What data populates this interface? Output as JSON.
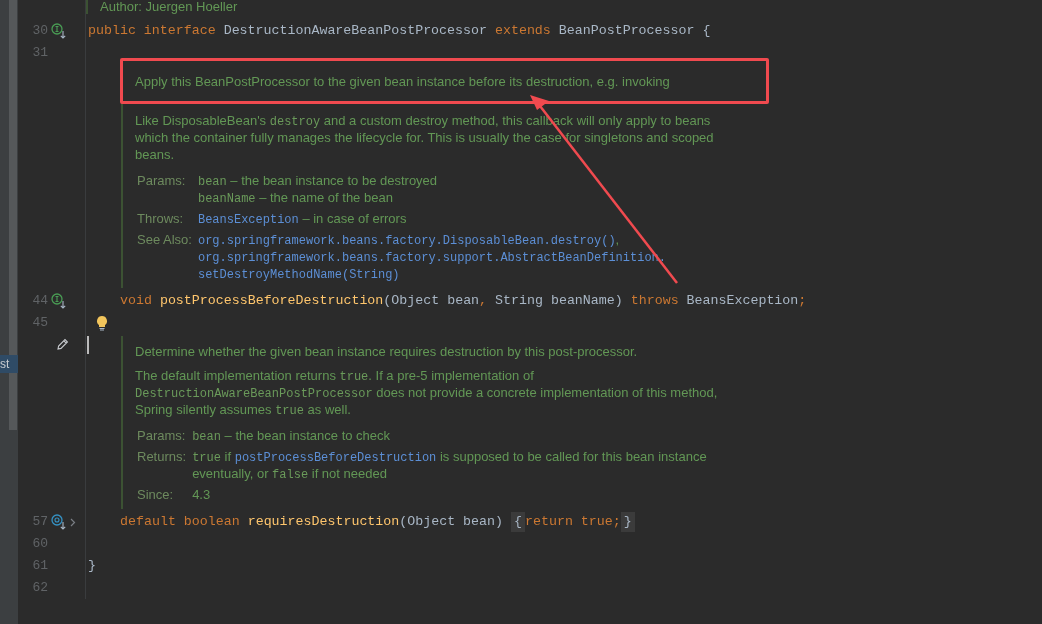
{
  "side_tab": {
    "label": "st"
  },
  "rows": [
    {
      "kind": "doc_tail",
      "text": "Author: Juergen Hoeller"
    },
    {
      "kind": "code",
      "number": "30",
      "marker": {
        "kind": "implemented"
      },
      "folded": false,
      "indented": false,
      "tokens": [
        {
          "t": "public interface ",
          "kind": "keyword"
        },
        {
          "t": "DestructionAwareBeanPostProcessor ",
          "kind": "plain"
        },
        {
          "t": "extends ",
          "kind": "keyword"
        },
        {
          "t": "BeanPostProcessor {",
          "kind": "plain"
        }
      ]
    },
    {
      "kind": "code",
      "number": "31",
      "folded": false,
      "indented": false,
      "tokens": []
    },
    {
      "kind": "doc",
      "editable": false,
      "paragraphs": [
        [
          {
            "t": "Apply this BeanPostProcessor to the given bean instance before its destruction, e.g. invoking",
            "kind": "text"
          }
        ],
        [
          {
            "t": "Like DisposableBean's ",
            "kind": "text"
          },
          {
            "t": "destroy",
            "kind": "code"
          },
          {
            "t": " and a custom destroy method, this callback will only apply to beans which the container fully manages the lifecycle for. This is usually the case for singletons and scoped beans.",
            "kind": "text"
          }
        ]
      ],
      "tags": [
        {
          "label": "Params:",
          "entries": [
            [
              {
                "t": "bean",
                "kind": "code"
              },
              {
                "t": " – the bean instance to be destroyed",
                "kind": "text"
              }
            ],
            [
              {
                "t": "beanName",
                "kind": "code"
              },
              {
                "t": " – the name of the bean",
                "kind": "text"
              }
            ]
          ]
        },
        {
          "label": "Throws:",
          "entries": [
            [
              {
                "t": "BeansException",
                "kind": "link"
              },
              {
                "t": " – in case of errors",
                "kind": "text"
              }
            ]
          ]
        },
        {
          "label": "See Also:",
          "entries": [
            [
              {
                "t": "org.springframework.beans.factory.DisposableBean.destroy()",
                "kind": "link"
              },
              {
                "t": ",",
                "kind": "text"
              }
            ],
            [
              {
                "t": "org.springframework.beans.factory.support.AbstractBeanDefinition.",
                "kind": "link"
              }
            ],
            [
              {
                "t": "setDestroyMethodName(String)",
                "kind": "link"
              }
            ]
          ]
        }
      ]
    },
    {
      "kind": "code",
      "number": "44",
      "marker": {
        "kind": "implemented"
      },
      "folded": false,
      "indented": true,
      "tokens": [
        {
          "t": "void ",
          "kind": "keyword"
        },
        {
          "t": "postProcessBeforeDestruction",
          "kind": "method"
        },
        {
          "t": "(Object bean",
          "kind": "plain"
        },
        {
          "t": ", ",
          "kind": "keyword"
        },
        {
          "t": "String beanName) ",
          "kind": "plain"
        },
        {
          "t": "throws ",
          "kind": "keyword"
        },
        {
          "t": "BeansException",
          "kind": "plain"
        },
        {
          "t": ";",
          "kind": "keyword"
        }
      ]
    },
    {
      "kind": "code",
      "number": "45",
      "folded": false,
      "indented": false,
      "bulb": true,
      "tokens": []
    },
    {
      "kind": "doc",
      "editable": true,
      "paragraphs": [
        [
          {
            "t": "Determine whether the given bean instance requires destruction by this post-processor.",
            "kind": "text"
          }
        ],
        [
          {
            "t": "The default implementation returns ",
            "kind": "text"
          },
          {
            "t": "true",
            "kind": "code"
          },
          {
            "t": ". If a pre-5 implementation of ",
            "kind": "text"
          },
          {
            "t": "DestructionAwareBeanPostProcessor",
            "kind": "code"
          },
          {
            "t": " does not provide a concrete implementation of this method, Spring silently assumes ",
            "kind": "text"
          },
          {
            "t": "true",
            "kind": "code"
          },
          {
            "t": " as well.",
            "kind": "text"
          }
        ]
      ],
      "tags": [
        {
          "label": "Params:",
          "entries": [
            [
              {
                "t": "bean",
                "kind": "code"
              },
              {
                "t": " – the bean instance to check",
                "kind": "text"
              }
            ]
          ]
        },
        {
          "label": "Returns:",
          "entries": [
            [
              {
                "t": "true",
                "kind": "code"
              },
              {
                "t": " if ",
                "kind": "text"
              },
              {
                "t": "postProcessBeforeDestruction",
                "kind": "link"
              },
              {
                "t": " is supposed to be called for this bean instance eventually, or ",
                "kind": "text"
              },
              {
                "t": "false",
                "kind": "code"
              },
              {
                "t": " if not needed",
                "kind": "text"
              }
            ]
          ]
        },
        {
          "label": "Since:",
          "entries": [
            [
              {
                "t": "4.3",
                "kind": "text"
              }
            ]
          ]
        }
      ]
    },
    {
      "kind": "code",
      "number": "57",
      "marker": {
        "kind": "overridden"
      },
      "folded": true,
      "indented": true,
      "tokens": [
        {
          "t": "default boolean ",
          "kind": "keyword"
        },
        {
          "t": "requiresDestruction",
          "kind": "method"
        },
        {
          "t": "(Object bean) ",
          "kind": "plain"
        },
        {
          "t": "{",
          "kind": "fold"
        },
        {
          "t": "return true;",
          "kind": "keyword"
        },
        {
          "t": "}",
          "kind": "fold"
        }
      ]
    },
    {
      "kind": "code",
      "number": "60",
      "folded": false,
      "indented": false,
      "tokens": []
    },
    {
      "kind": "code",
      "number": "61",
      "folded": false,
      "indented": false,
      "tokens": [
        {
          "t": "}",
          "kind": "plain"
        }
      ]
    },
    {
      "kind": "code",
      "number": "62",
      "folded": false,
      "indented": false,
      "tokens": []
    }
  ]
}
